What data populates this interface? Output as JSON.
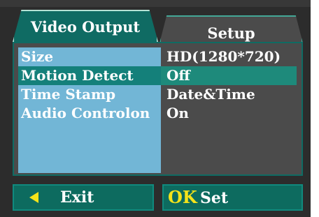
{
  "tabs": {
    "video_output": "Video Output",
    "setup": "Setup"
  },
  "settings": [
    {
      "label": "Size",
      "value": "HD(1280*720)"
    },
    {
      "label": "Motion Detect",
      "value": "Off"
    },
    {
      "label": "Time Stamp",
      "value": "Date&Time"
    },
    {
      "label": "Audio Controlon",
      "value": "On"
    }
  ],
  "selected_index": 1,
  "buttons": {
    "exit_label": "Exit",
    "ok_label": "OK",
    "set_label": "Set"
  },
  "icons": {
    "exit": "triangle-left-icon"
  },
  "colors": {
    "accent_teal": "#0f6b63",
    "highlight": "#1e8a7b",
    "left_column": "#72b6d6",
    "ok_yellow": "#f5e31a"
  }
}
